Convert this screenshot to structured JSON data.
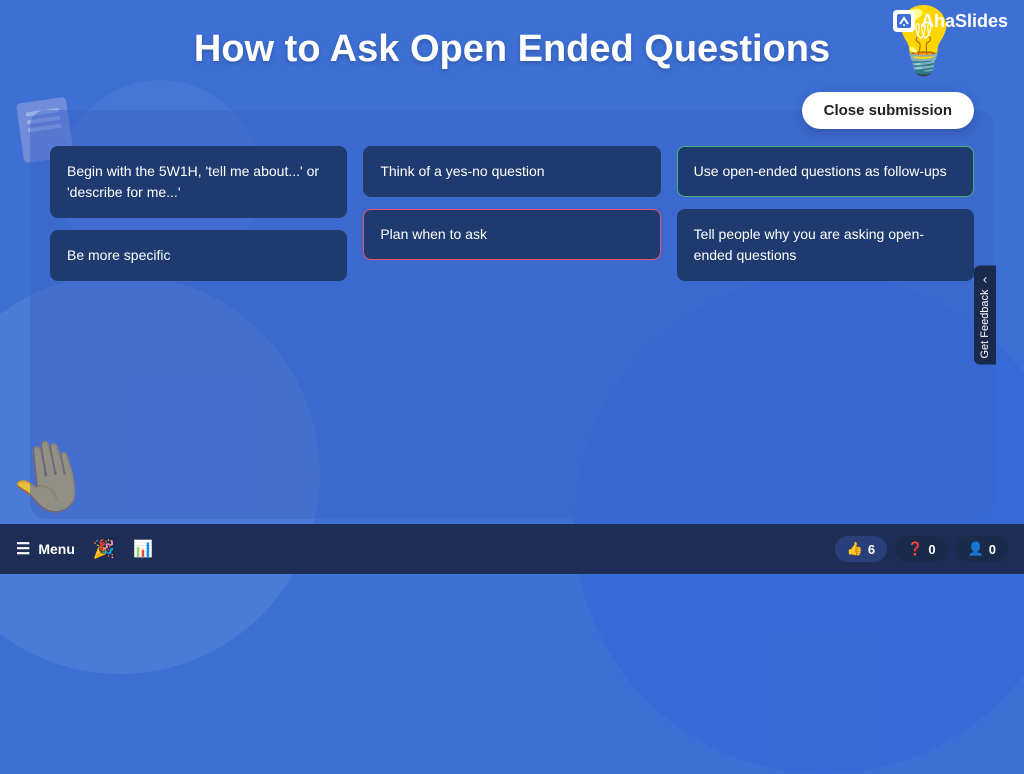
{
  "brand": {
    "logo_text": "AhaSlides",
    "logo_icon": "A"
  },
  "header": {
    "title": "How to Ask Open Ended Questions"
  },
  "close_button": {
    "label": "Close submission"
  },
  "cards": {
    "column1": [
      {
        "text": "Begin with the 5W1H, 'tell me about...' or 'describe for me...'",
        "border": "normal"
      },
      {
        "text": "Be more specific",
        "border": "normal"
      }
    ],
    "column2": [
      {
        "text": "Think of a yes-no question",
        "border": "normal"
      },
      {
        "text": "Plan when to ask",
        "border": "highlighted"
      }
    ],
    "column3": [
      {
        "text": "Use open-ended questions as follow-ups",
        "border": "green"
      },
      {
        "text": "Tell people why you are asking open-ended questions",
        "border": "normal"
      }
    ]
  },
  "feedback_tab": {
    "label": "Get Feedback",
    "arrow": "‹"
  },
  "bottom_bar": {
    "menu_label": "Menu",
    "stats": [
      {
        "icon": "👍",
        "count": "6"
      },
      {
        "icon": "❓",
        "count": "0"
      },
      {
        "icon": "👤",
        "count": "0"
      }
    ]
  },
  "decorations": {
    "lightbulb": "💡",
    "notes": "📋",
    "hand": "✋"
  }
}
